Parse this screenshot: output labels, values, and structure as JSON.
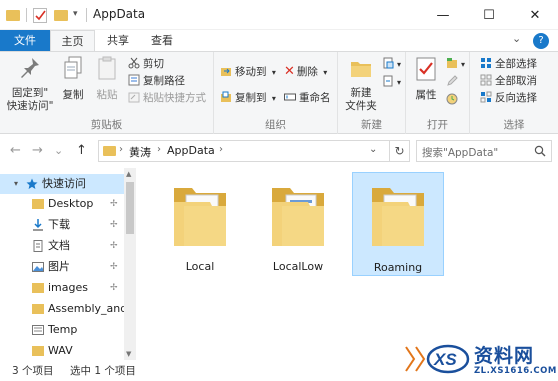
{
  "window": {
    "title": "AppData",
    "minimize_glyph": "—",
    "maximize_glyph": "☐",
    "close_glyph": "✕",
    "quick_access_dropdown": "▾"
  },
  "tabs": {
    "file": "文件",
    "home": "主页",
    "share": "共享",
    "view": "查看",
    "expand": "⌄",
    "help": "?"
  },
  "ribbon": {
    "clipboard": {
      "label": "剪贴板",
      "pin": "固定到\"\n快速访问\"",
      "pin_line1": "固定到\"",
      "pin_line2": "快速访问\"",
      "copy": "复制",
      "paste": "粘贴",
      "cut": "剪切",
      "copy_path": "复制路径",
      "paste_shortcut": "粘贴快捷方式"
    },
    "organize": {
      "label": "组织",
      "move_to": "移动到",
      "copy_to": "复制到",
      "delete": "删除",
      "rename": "重命名",
      "dropdown": "▾"
    },
    "new": {
      "label": "新建",
      "new_folder_line1": "新建",
      "new_folder_line2": "文件夹"
    },
    "open": {
      "label": "打开",
      "properties": "属性"
    },
    "select": {
      "label": "选择",
      "select_all": "全部选择",
      "select_none": "全部取消",
      "invert": "反向选择"
    }
  },
  "navigation": {
    "back": "←",
    "forward": "→",
    "recent": "⌄",
    "up": "↑",
    "crumbs": [
      "黄涛",
      "AppData"
    ],
    "crumb_sep": "›",
    "address_dropdown": "⌄",
    "refresh": "↻",
    "search_placeholder": "搜索\"AppData\""
  },
  "nav_pane": {
    "items": [
      {
        "label": "快速访问",
        "icon": "star-icon",
        "expanded": true
      },
      {
        "label": "Desktop",
        "icon": "folder-icon",
        "pinned": true
      },
      {
        "label": "下载",
        "icon": "download-icon",
        "pinned": true
      },
      {
        "label": "文档",
        "icon": "document-icon",
        "pinned": true
      },
      {
        "label": "图片",
        "icon": "pictures-icon",
        "pinned": true
      },
      {
        "label": "images",
        "icon": "folder-icon",
        "pinned": true
      },
      {
        "label": "Assembly_and_",
        "icon": "folder-icon",
        "pinned": false
      },
      {
        "label": "Temp",
        "icon": "temp-icon",
        "pinned": false
      },
      {
        "label": "WAV",
        "icon": "folder-icon",
        "pinned": false
      }
    ],
    "expand_glyph": "▾",
    "pin_glyph": "✢"
  },
  "files": [
    {
      "name": "Local",
      "selected": false
    },
    {
      "name": "LocalLow",
      "selected": false
    },
    {
      "name": "Roaming",
      "selected": true
    }
  ],
  "status_bar": {
    "item_count": "3 个项目",
    "selected": "选中 1 个项目"
  },
  "watermark": {
    "brand": "资料网",
    "url": "ZL.XS1616.COM"
  },
  "colors": {
    "accent": "#1979ca",
    "folder": "#e9c05a",
    "selection": "#cce8ff",
    "selection_border": "#99d1ff",
    "delete_red": "#d93025"
  }
}
